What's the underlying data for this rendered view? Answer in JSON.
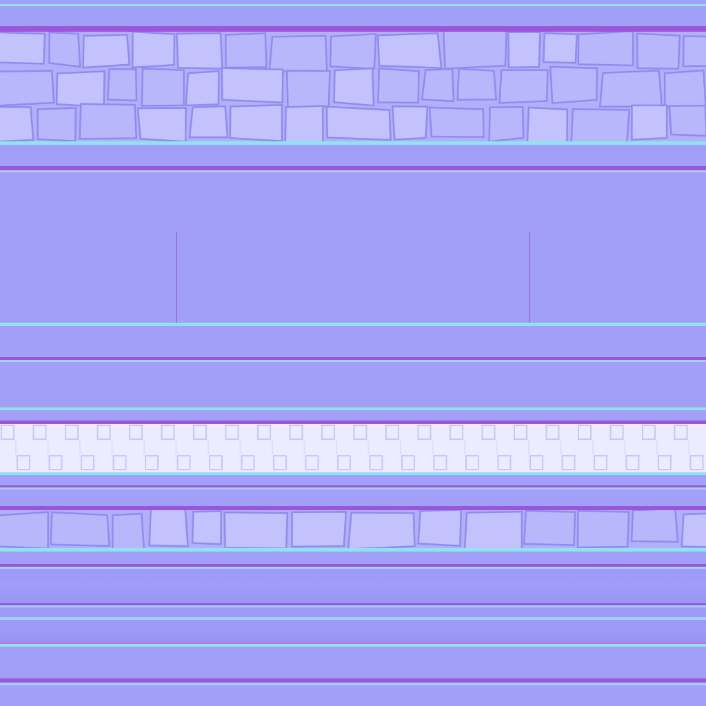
{
  "texture": {
    "kind": "normal-map",
    "colors": {
      "flat": "#a29ff9",
      "edge_up": "#8fe3ea",
      "edge_down": "#9a55da",
      "stone_light": "#c3c2fd",
      "stone_dark": "#8f8cef",
      "tile_light": "#f0f0ff",
      "tile_frame": "#c8c6fb"
    },
    "bands": [
      "top-strip",
      "stone-band-large",
      "plain-panel",
      "plain-strip",
      "tile-band",
      "stone-band-small",
      "brushed-bands",
      "bottom-strip"
    ]
  }
}
